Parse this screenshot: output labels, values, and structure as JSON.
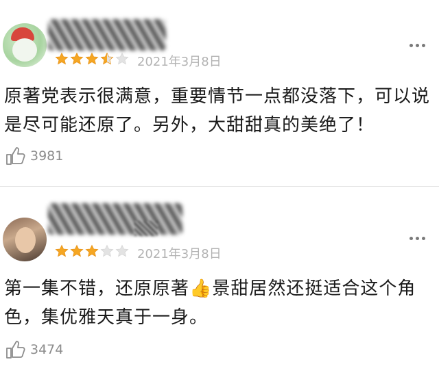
{
  "reviews": [
    {
      "avatar_icon": "user-avatar",
      "rating": 3.5,
      "rating_max": 5,
      "date": "2021年3月8日",
      "text": "原著党表示很满意，重要情节一点都没落下，可以说是尽可能还原了。另外，大甜甜真的美绝了！",
      "likes": "3981"
    },
    {
      "avatar_icon": "user-avatar",
      "rating": 3,
      "rating_max": 5,
      "date": "2021年3月8日",
      "text": "第一集不错，还原原著👍景甜居然还挺适合这个角色，集优雅天真于一身。",
      "likes": "3474"
    }
  ],
  "colors": {
    "star_filled": "#f5a623",
    "star_empty": "#e3e3e3",
    "meta_gray": "#b3b3b3"
  }
}
